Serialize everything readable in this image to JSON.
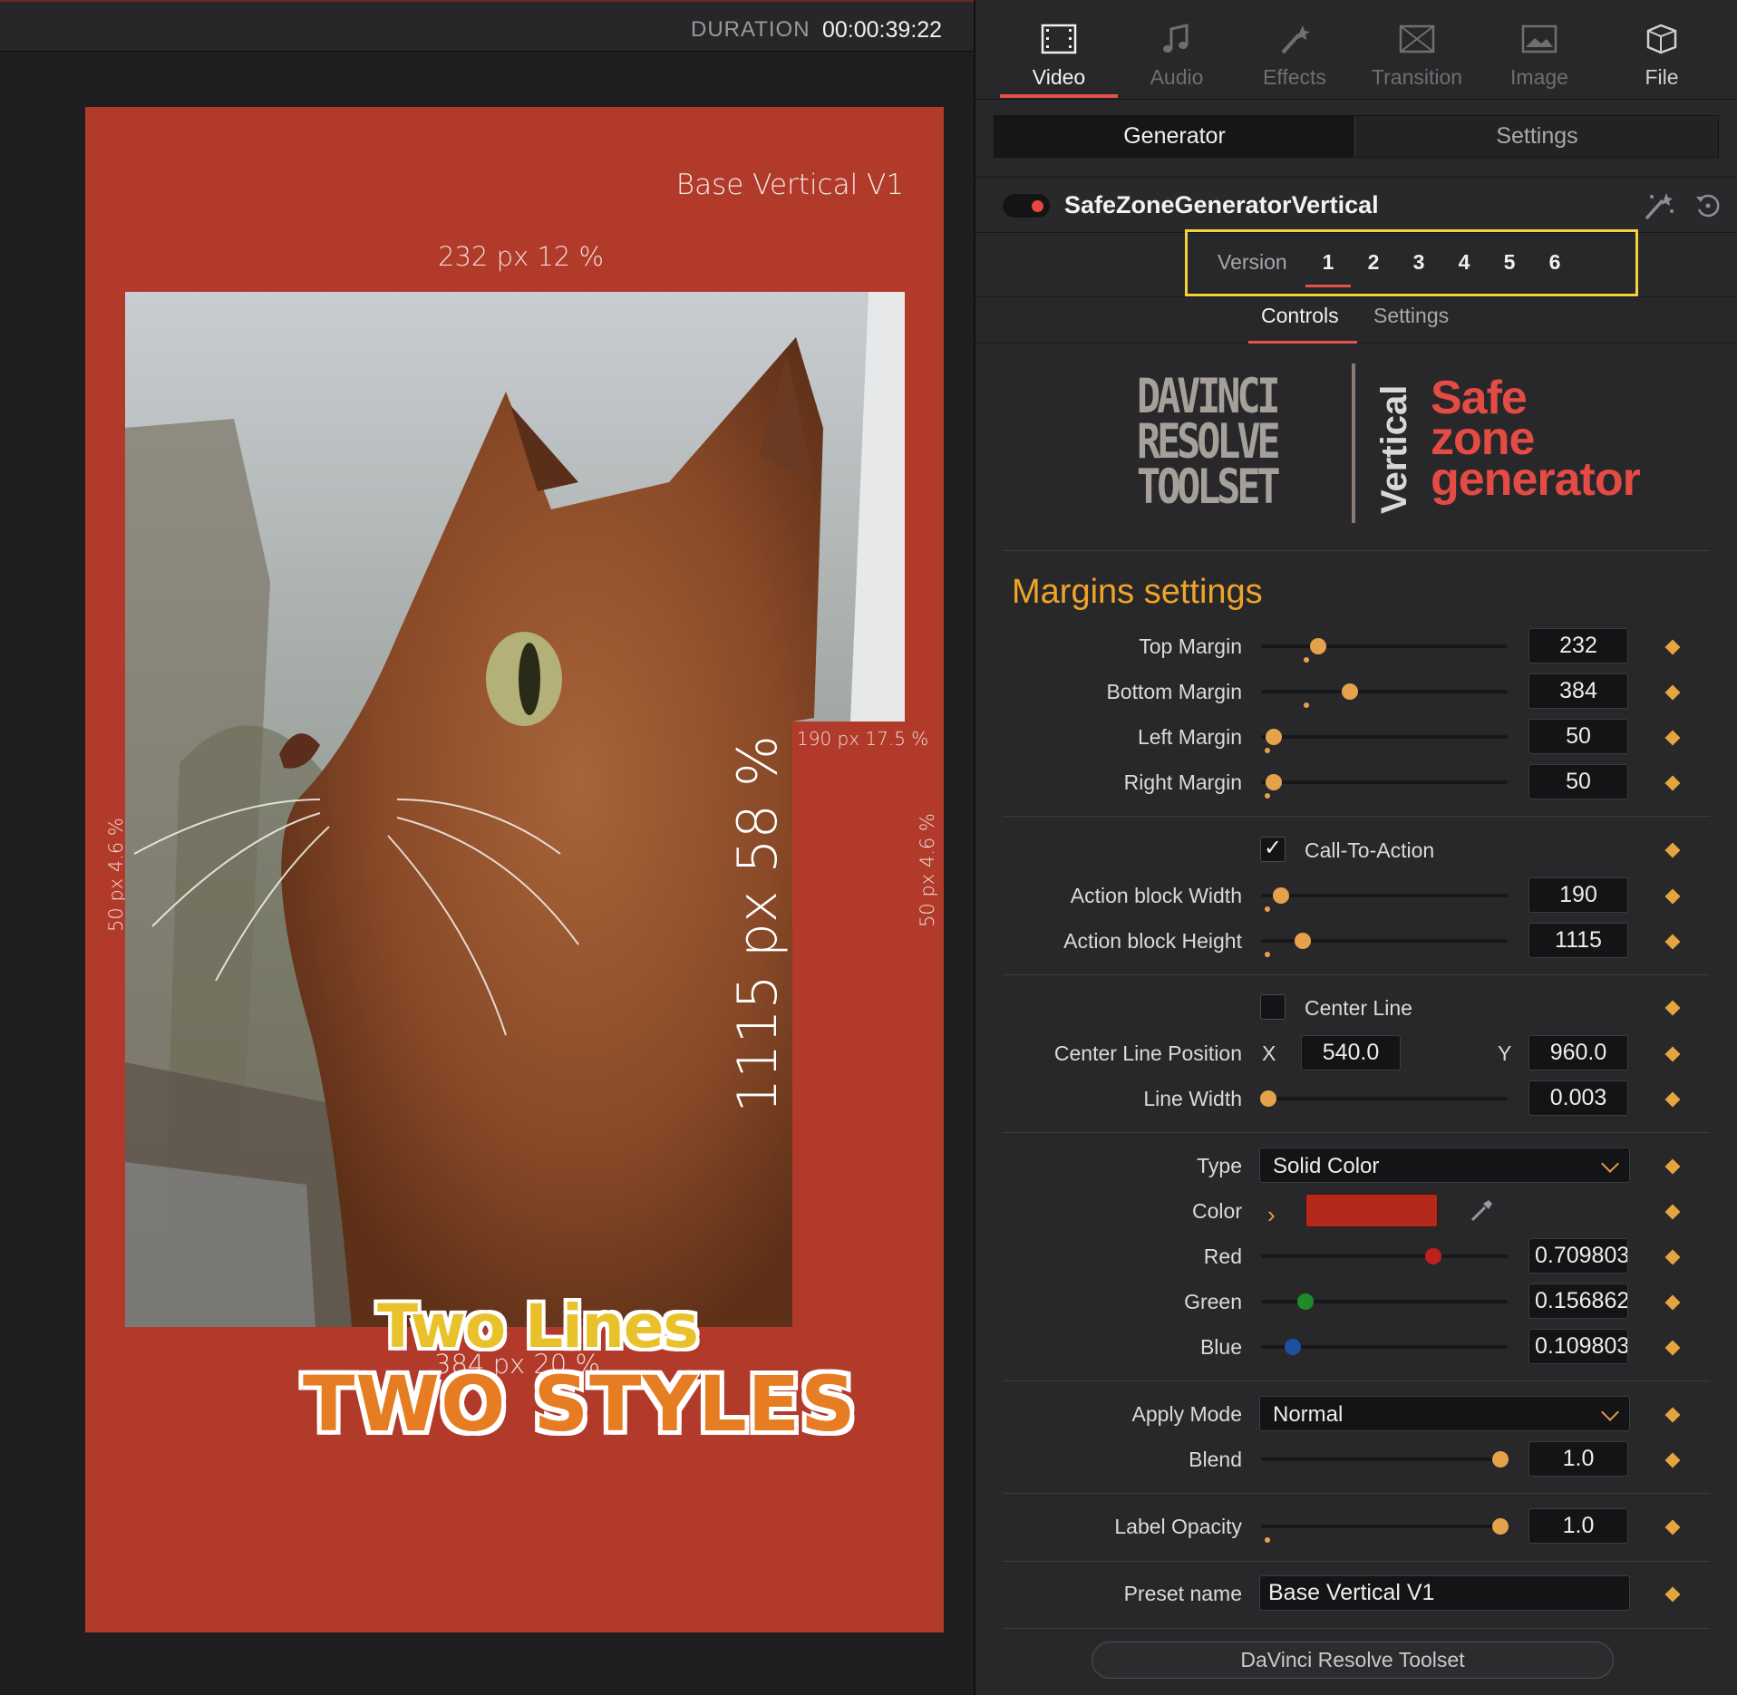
{
  "viewer": {
    "duration_label": "DURATION",
    "duration_value": "00:00:39:22",
    "canvas": {
      "preset_title": "Base Vertical V1",
      "top_measure": "232 px 12 %",
      "bottom_measure": "384 px 20 %",
      "left_measure": "50 px 4.6 %",
      "right_measure": "50 px 4.6 %",
      "action_width_measure": "190 px 17.5 %",
      "action_height_measure": "1115 px 58 %",
      "title_line1": "Two Lines",
      "title_line2": "TWO STYLES"
    }
  },
  "inspector": {
    "tabs": [
      {
        "label": "Video",
        "icon": "film-strip-icon",
        "active": true
      },
      {
        "label": "Audio",
        "icon": "music-note-icon",
        "active": false
      },
      {
        "label": "Effects",
        "icon": "magic-wand-icon",
        "active": false
      },
      {
        "label": "Transition",
        "icon": "transition-icon",
        "active": false
      },
      {
        "label": "Image",
        "icon": "image-icon",
        "active": false
      },
      {
        "label": "File",
        "icon": "file-cube-icon",
        "active": false
      }
    ],
    "segment": {
      "generator": "Generator",
      "settings": "Settings",
      "active": "Generator"
    },
    "node": {
      "title": "SafeZoneGeneratorVertical",
      "enabled": true
    },
    "version": {
      "label": "Version",
      "items": [
        "1",
        "2",
        "3",
        "4",
        "5",
        "6"
      ],
      "active": "1"
    },
    "sub_tabs": {
      "controls": "Controls",
      "settings": "Settings",
      "active": "Controls"
    },
    "logo": {
      "left_lines": [
        "DAVINCI",
        "RESOLVE",
        "TOOLSET"
      ],
      "vertical": "Vertical",
      "right_lines": [
        "Safe",
        "zone",
        "generator"
      ]
    },
    "section_title": "Margins settings",
    "margins": {
      "top": {
        "label": "Top Margin",
        "value": "232",
        "fraction": 0.23
      },
      "bottom": {
        "label": "Bottom Margin",
        "value": "384",
        "fraction": 0.36
      },
      "left": {
        "label": "Left Margin",
        "value": "50",
        "fraction": 0.05
      },
      "right": {
        "label": "Right Margin",
        "value": "50",
        "fraction": 0.05
      }
    },
    "cta": {
      "checkbox_label": "Call-To-Action",
      "checked": true,
      "width": {
        "label": "Action block Width",
        "value": "190",
        "fraction": 0.08
      },
      "height": {
        "label": "Action block Height",
        "value": "1115",
        "fraction": 0.17
      }
    },
    "center_line": {
      "checkbox_label": "Center Line",
      "checked": false,
      "position_label": "Center Line Position",
      "x_label": "X",
      "x_value": "540.0",
      "y_label": "Y",
      "y_value": "960.0",
      "width": {
        "label": "Line Width",
        "value": "0.003",
        "fraction": 0.03
      }
    },
    "fill": {
      "type_label": "Type",
      "type_value": "Solid Color",
      "color_label": "Color",
      "color_hex": "#b5281c",
      "red": {
        "label": "Red",
        "value": "0.709803",
        "fraction": 0.7,
        "color": "#c21f1f"
      },
      "green": {
        "label": "Green",
        "value": "0.156862",
        "fraction": 0.18,
        "color": "#1f8a2a"
      },
      "blue": {
        "label": "Blue",
        "value": "0.109803",
        "fraction": 0.13,
        "color": "#1f4fa0"
      }
    },
    "apply": {
      "mode_label": "Apply Mode",
      "mode_value": "Normal",
      "blend": {
        "label": "Blend",
        "value": "1.0",
        "fraction": 0.97
      }
    },
    "label_opacity": {
      "label": "Label Opacity",
      "value": "1.0",
      "fraction": 0.97
    },
    "preset": {
      "label": "Preset name",
      "value": "Base Vertical V1"
    },
    "footer_button": "DaVinci Resolve Toolset",
    "accent_color": "#e3534a",
    "keyframe_color": "#e5a53e",
    "highlight_color": "#f2d33a"
  }
}
